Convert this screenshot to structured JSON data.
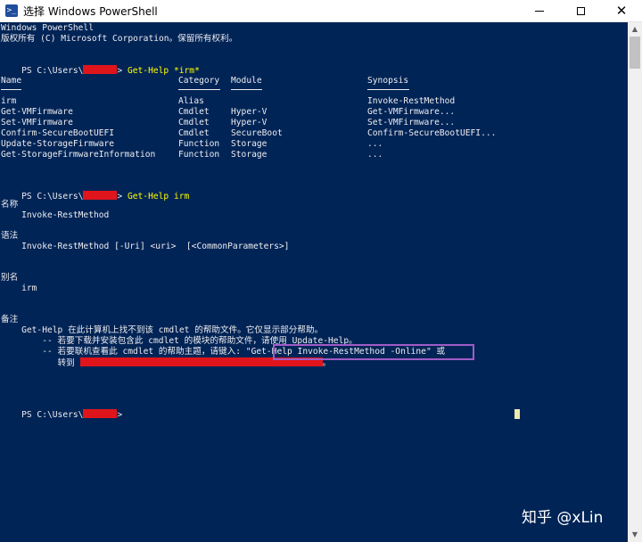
{
  "window": {
    "title": "选择 Windows PowerShell",
    "app_icon": "powershell-icon",
    "minimize_icon": "minimize-icon",
    "maximize_icon": "maximize-icon",
    "close_icon": "close-icon"
  },
  "console": {
    "background": "#012456",
    "header": [
      "Windows PowerShell",
      "版权所有 (C) Microsoft Corporation。保留所有权利。"
    ],
    "prompts": [
      {
        "prefix": "PS C:\\Users\\",
        "suffix": "> ",
        "command": "Get-Help *irm*"
      },
      {
        "prefix": "PS C:\\Users\\",
        "suffix": "> ",
        "command": "Get-Help irm"
      },
      {
        "prefix": "PS C:\\Users\\",
        "suffix": ">",
        "command": ""
      }
    ],
    "table": {
      "headers": [
        "Name",
        "Category",
        "Module",
        "Synopsis"
      ],
      "rows": [
        [
          "irm",
          "Alias",
          "",
          "Invoke-RestMethod"
        ],
        [
          "Get-VMFirmware",
          "Cmdlet",
          "Hyper-V",
          "Get-VMFirmware..."
        ],
        [
          "Set-VMFirmware",
          "Cmdlet",
          "Hyper-V",
          "Set-VMFirmware..."
        ],
        [
          "Confirm-SecureBootUEFI",
          "Cmdlet",
          "SecureBoot",
          "Confirm-SecureBootUEFI..."
        ],
        [
          "Update-StorageFirmware",
          "Function",
          "Storage",
          "..."
        ],
        [
          "Get-StorageFirmwareInformation",
          "Function",
          "Storage",
          "..."
        ]
      ]
    },
    "help": {
      "name_heading": "名称",
      "name_value": "    Invoke-RestMethod",
      "syntax_heading": "语法",
      "syntax_value": "    Invoke-RestMethod [-Uri] <uri>  [<CommonParameters>]",
      "alias_heading": "别名",
      "alias_value": "    irm",
      "remarks_heading": "备注",
      "remarks": [
        "    Get-Help 在此计算机上找不到该 cmdlet 的帮助文件。它仅显示部分帮助。",
        "        -- 若要下载并安装包含此 cmdlet 的模块的帮助文件，请使用 Update-Help。",
        "        -- 若要联机查看此 cmdlet 的帮助主题，请键入: \"Get-Help Invoke-RestMethod -Online\" 或",
        "           转到 ",
        "。"
      ]
    },
    "redaction_color": "#e0151b",
    "highlight_color": "#a05cc7",
    "prompt_command_color": "#ffff00"
  },
  "watermark": "知乎 @xLin"
}
